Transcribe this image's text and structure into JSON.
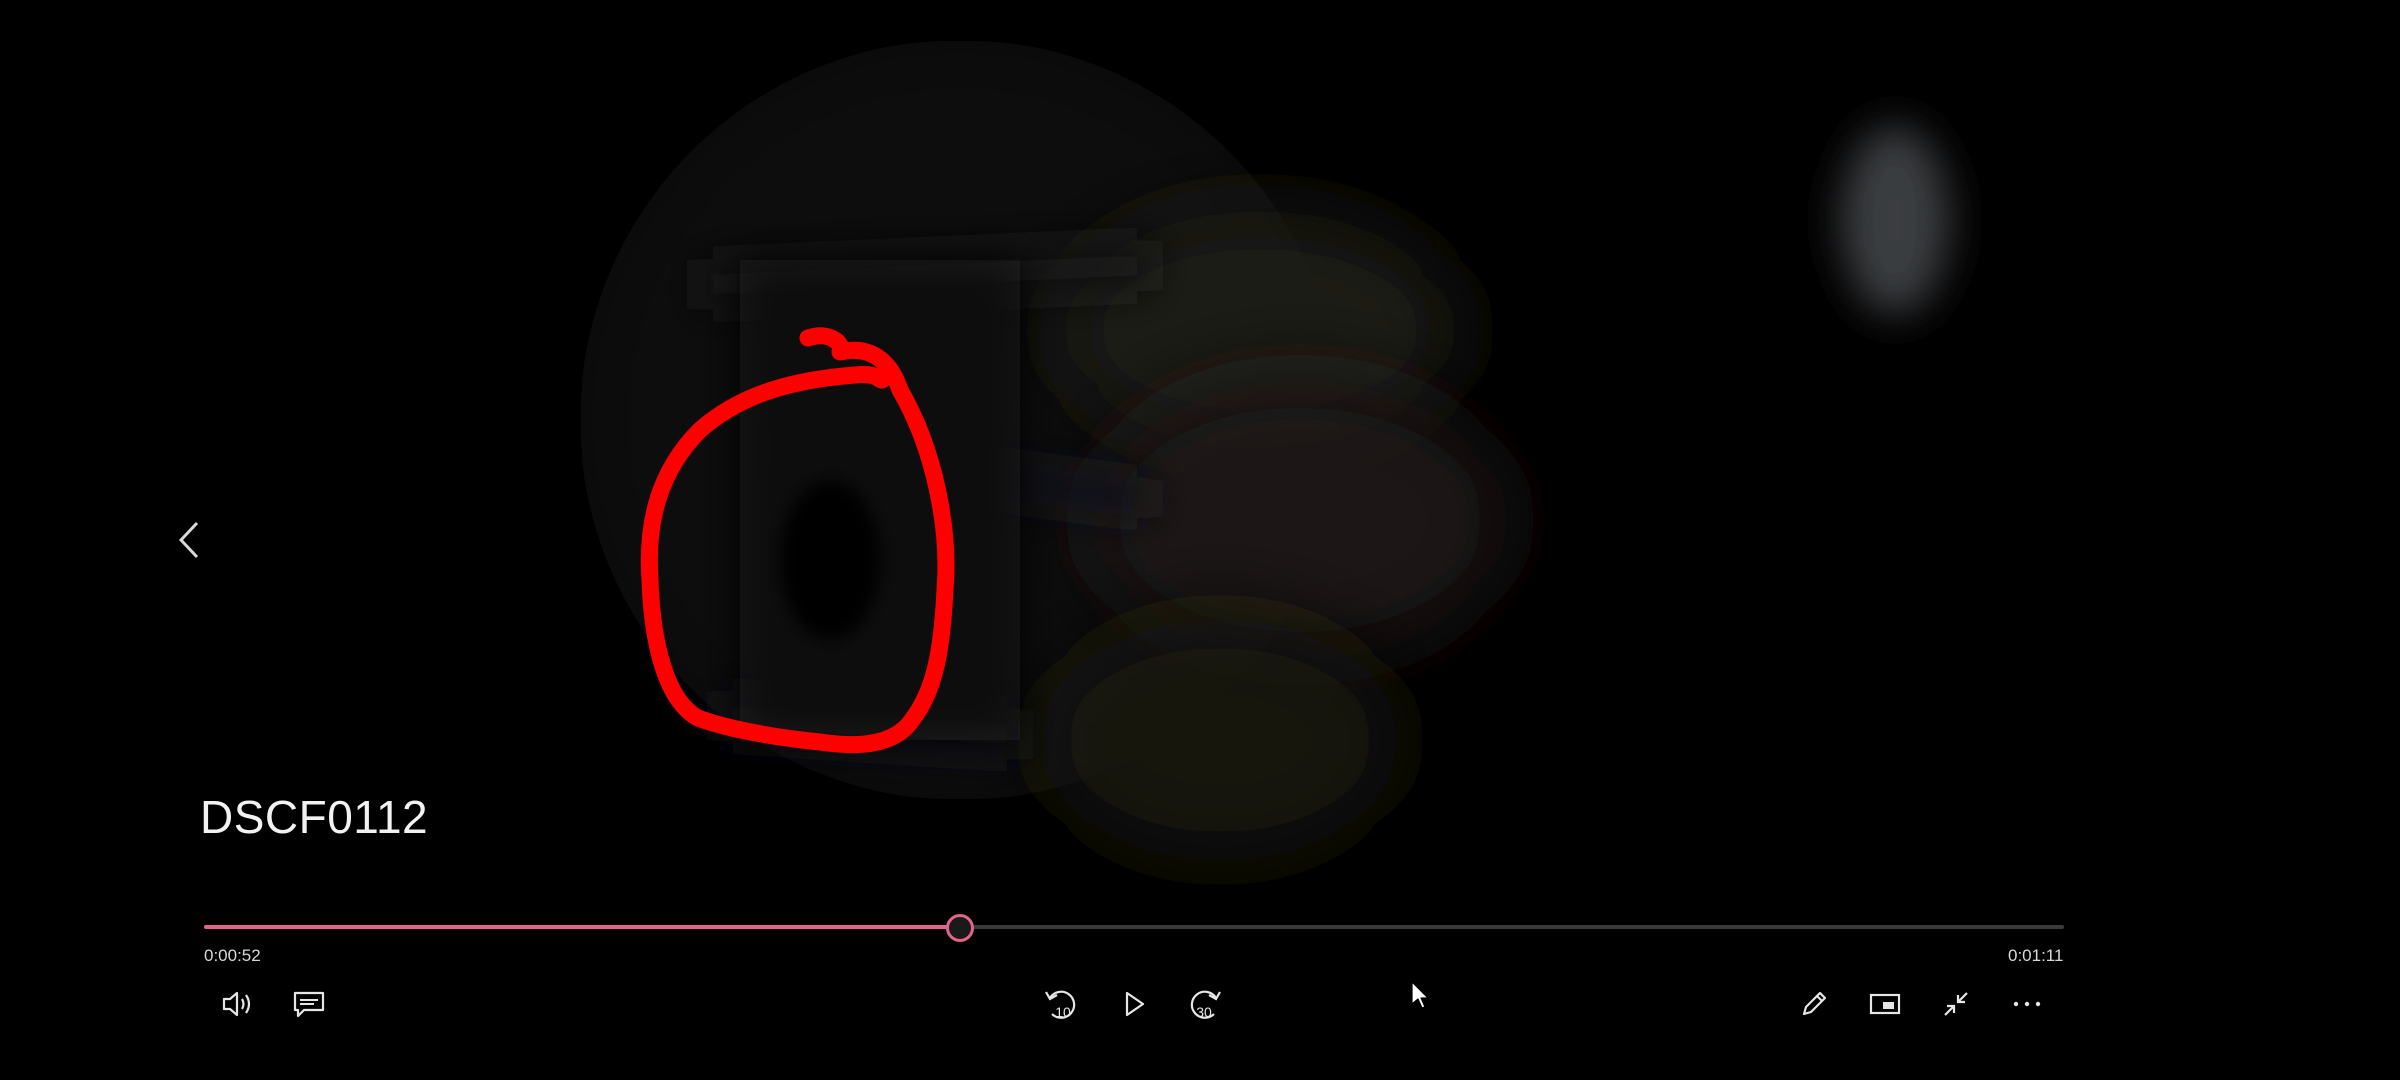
{
  "video": {
    "title": "DSCF0112",
    "elapsed": "0:00:52",
    "total": "0:01:11",
    "progress_fraction": 0.406
  },
  "controls": {
    "skip_back_label": "10",
    "skip_forward_label": "30"
  },
  "colors": {
    "accent": "#e2638a",
    "annotation": "#ff0000",
    "icon": "#e6e6e6",
    "text": "#f2f2f2"
  },
  "icons": {
    "prev": "chevron-left-icon",
    "volume": "volume-icon",
    "captions": "captions-icon",
    "skip_back": "skip-back-10-icon",
    "play": "play-icon",
    "skip_forward": "skip-forward-30-icon",
    "edit": "pencil-icon",
    "mini_view": "mini-view-icon",
    "exit_fullscreen": "exit-fullscreen-icon",
    "more": "more-icon"
  }
}
